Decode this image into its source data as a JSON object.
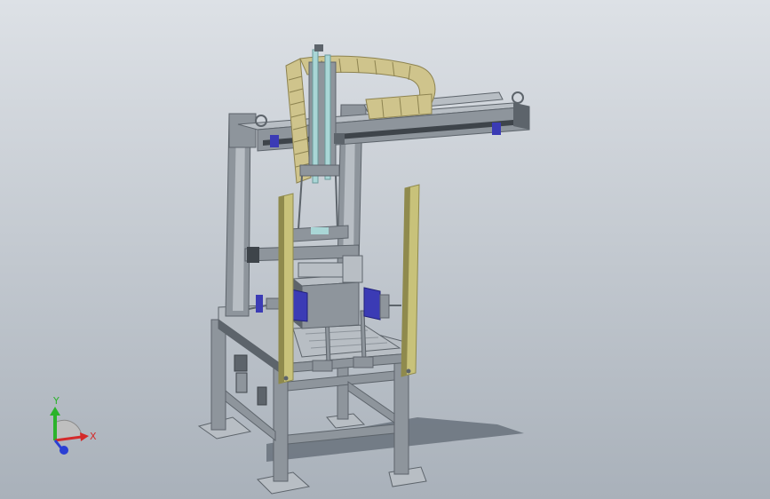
{
  "window": {
    "view": "isometric-3d-model",
    "background": {
      "top": "#dde1e6",
      "bottom": "#a9b1ba"
    }
  },
  "model": {
    "colors": {
      "frame_face": "#8e959c",
      "frame_dark": "#5d646b",
      "frame_light": "#b8bec4",
      "guard_yellow": "#c8c27a",
      "guard_dark": "#8f8a4d",
      "drag_chain": "#cfc48c",
      "drag_chain_dark": "#8d8350",
      "cylinder": "#a9d6d6",
      "motor_blue": "#3b3bb5",
      "base_shadow": "#5f6873"
    }
  },
  "triad": {
    "x_label": "X",
    "y_label": "Y",
    "x_color": "#d42a2a",
    "y_color": "#2bb32b",
    "z_color": "#2a3fd4"
  }
}
